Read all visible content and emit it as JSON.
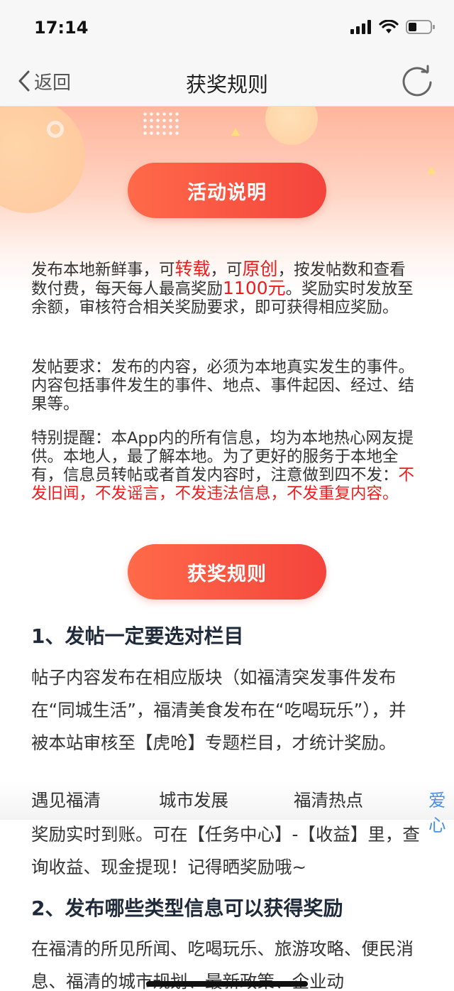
{
  "status": {
    "time": "17:14"
  },
  "nav": {
    "back_label": "返回",
    "title": "获奖规则"
  },
  "section1_button": "活动说明",
  "intro": {
    "p1_a": "发布本地新鲜事，可",
    "p1_b": "转载",
    "p1_c": "，可",
    "p1_d": "原创",
    "p1_e": "，按发帖数和查看数付费，每天每人最高奖励",
    "p1_f": "1100元",
    "p1_g": "。奖励实时发放至余额，审核符合相关奖励要求，即可获得相应奖励。",
    "p2": "发帖要求：发布的内容，必须为本地真实发生的事件。内容包括事件发生的事件、地点、事件起因、经过、结果等。",
    "p3_a": "特别提醒：本App内的所有信息，均为本地热心网友提供。本地人，最了解本地。为了更好的服务于本地全有，信息员转帖或者首发内容时，注意做到四不发：",
    "p3_b": "不发旧闻，不发谣言，不发违法信息，不发重复内容。"
  },
  "section2_button": "获奖规则",
  "rules": {
    "h1": "1、发帖一定要选对栏目",
    "t1": "帖子内容发布在相应版块（如福清突发事件发布在“同城生活”，福清美食发布在“吃喝玩乐”），并被本站审核至【虎呛】专题栏目，才统计奖励。",
    "categories": [
      "遇见福清",
      "城市发展",
      "福清热点",
      "爱心"
    ],
    "t2": "奖励实时到账。可在【任务中心】-【收益】里，查询收益、现金提现！记得晒奖励哦~",
    "h2": "2、发布哪些类型信息可以获得奖励",
    "t3": "在福清的所见所闻、吃喝玩乐、旅游攻略、便民消息、福清的城市规划、最新政策、企业动"
  },
  "colors": {
    "accent": "#f4443c",
    "highlight": "#ee1c1c",
    "category_active": "#4a90e2"
  },
  "icons": [
    "chevron-left-icon",
    "refresh-icon",
    "signal-icon",
    "wifi-icon",
    "battery-icon"
  ]
}
